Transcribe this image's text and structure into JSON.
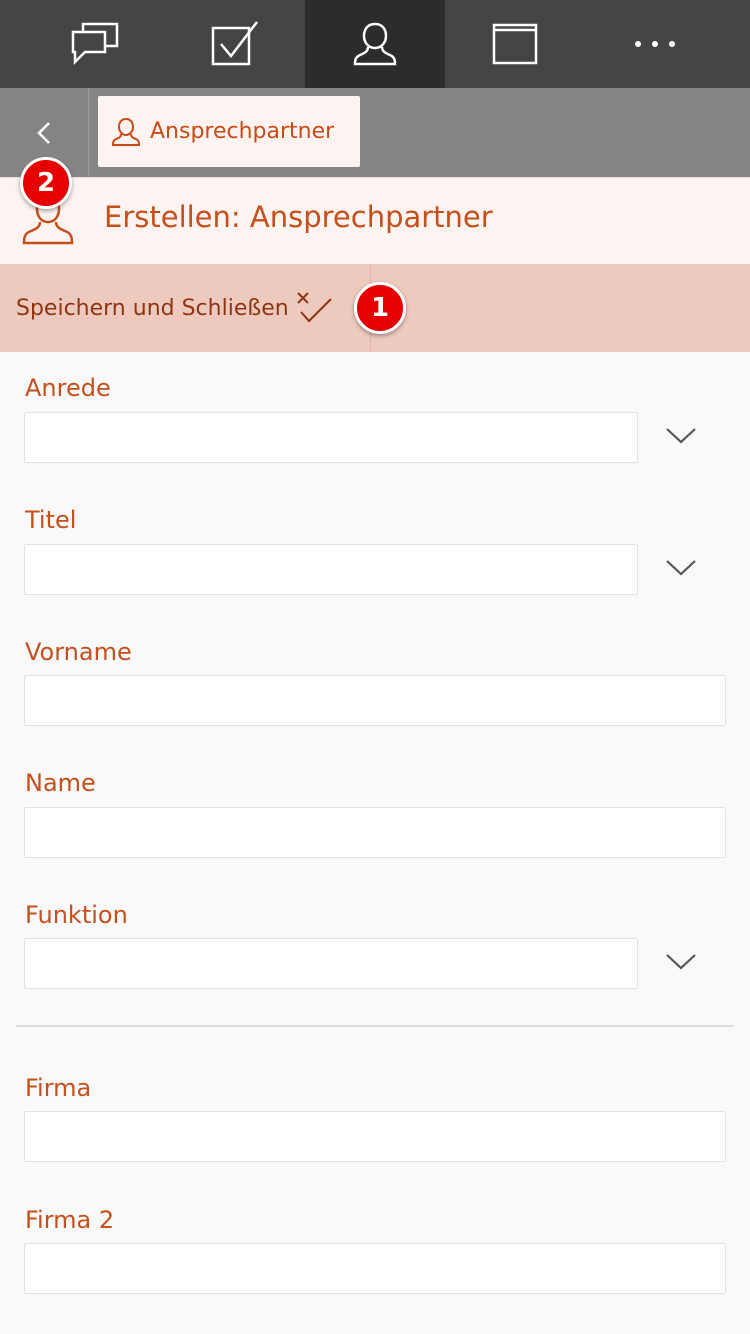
{
  "topnav": {
    "items": [
      {
        "icon": "chat-bubbles-icon",
        "active": false
      },
      {
        "icon": "checkbox-icon",
        "active": false
      },
      {
        "icon": "person-icon",
        "active": true
      },
      {
        "icon": "window-icon",
        "active": false
      },
      {
        "icon": "more-dots-icon",
        "active": false
      }
    ]
  },
  "breadcrumb": {
    "back_icon": "chevron-left-icon",
    "tab_icon": "person-icon",
    "tab_label": "Ansprechpartner"
  },
  "header": {
    "icon": "person-icon",
    "title": "Erstellen: Ansprechpartner"
  },
  "toolbar": {
    "save_label": "Speichern und Schließen",
    "save_icon": "save-close-check-icon"
  },
  "annotations": {
    "badge_1": "1",
    "badge_2": "2"
  },
  "form": {
    "anrede_label": "Anrede",
    "anrede_value": "",
    "titel_label": "Titel",
    "titel_value": "",
    "vorname_label": "Vorname",
    "vorname_value": "",
    "name_label": "Name",
    "name_value": "",
    "funktion_label": "Funktion",
    "funktion_value": "",
    "firma_label": "Firma",
    "firma_value": "",
    "firma2_label": "Firma 2",
    "firma2_value": ""
  },
  "colors": {
    "accent": "#c4501d",
    "nav_bg": "#444444",
    "toolbar_bg": "#eecabe",
    "header_bg": "#fdf3f1",
    "badge": "#e60000"
  }
}
